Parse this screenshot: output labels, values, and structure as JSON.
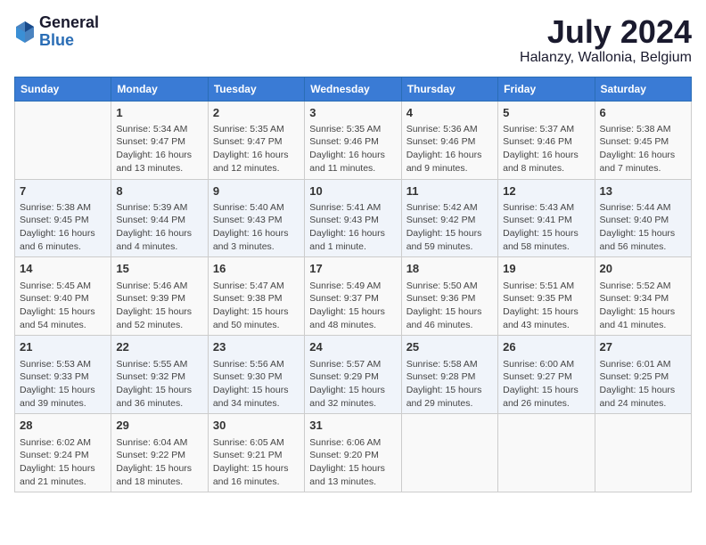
{
  "header": {
    "logo_general": "General",
    "logo_blue": "Blue",
    "month_title": "July 2024",
    "location": "Halanzy, Wallonia, Belgium"
  },
  "days_of_week": [
    "Sunday",
    "Monday",
    "Tuesday",
    "Wednesday",
    "Thursday",
    "Friday",
    "Saturday"
  ],
  "weeks": [
    [
      {
        "day": "",
        "content": ""
      },
      {
        "day": "1",
        "content": "Sunrise: 5:34 AM\nSunset: 9:47 PM\nDaylight: 16 hours\nand 13 minutes."
      },
      {
        "day": "2",
        "content": "Sunrise: 5:35 AM\nSunset: 9:47 PM\nDaylight: 16 hours\nand 12 minutes."
      },
      {
        "day": "3",
        "content": "Sunrise: 5:35 AM\nSunset: 9:46 PM\nDaylight: 16 hours\nand 11 minutes."
      },
      {
        "day": "4",
        "content": "Sunrise: 5:36 AM\nSunset: 9:46 PM\nDaylight: 16 hours\nand 9 minutes."
      },
      {
        "day": "5",
        "content": "Sunrise: 5:37 AM\nSunset: 9:46 PM\nDaylight: 16 hours\nand 8 minutes."
      },
      {
        "day": "6",
        "content": "Sunrise: 5:38 AM\nSunset: 9:45 PM\nDaylight: 16 hours\nand 7 minutes."
      }
    ],
    [
      {
        "day": "7",
        "content": "Sunrise: 5:38 AM\nSunset: 9:45 PM\nDaylight: 16 hours\nand 6 minutes."
      },
      {
        "day": "8",
        "content": "Sunrise: 5:39 AM\nSunset: 9:44 PM\nDaylight: 16 hours\nand 4 minutes."
      },
      {
        "day": "9",
        "content": "Sunrise: 5:40 AM\nSunset: 9:43 PM\nDaylight: 16 hours\nand 3 minutes."
      },
      {
        "day": "10",
        "content": "Sunrise: 5:41 AM\nSunset: 9:43 PM\nDaylight: 16 hours\nand 1 minute."
      },
      {
        "day": "11",
        "content": "Sunrise: 5:42 AM\nSunset: 9:42 PM\nDaylight: 15 hours\nand 59 minutes."
      },
      {
        "day": "12",
        "content": "Sunrise: 5:43 AM\nSunset: 9:41 PM\nDaylight: 15 hours\nand 58 minutes."
      },
      {
        "day": "13",
        "content": "Sunrise: 5:44 AM\nSunset: 9:40 PM\nDaylight: 15 hours\nand 56 minutes."
      }
    ],
    [
      {
        "day": "14",
        "content": "Sunrise: 5:45 AM\nSunset: 9:40 PM\nDaylight: 15 hours\nand 54 minutes."
      },
      {
        "day": "15",
        "content": "Sunrise: 5:46 AM\nSunset: 9:39 PM\nDaylight: 15 hours\nand 52 minutes."
      },
      {
        "day": "16",
        "content": "Sunrise: 5:47 AM\nSunset: 9:38 PM\nDaylight: 15 hours\nand 50 minutes."
      },
      {
        "day": "17",
        "content": "Sunrise: 5:49 AM\nSunset: 9:37 PM\nDaylight: 15 hours\nand 48 minutes."
      },
      {
        "day": "18",
        "content": "Sunrise: 5:50 AM\nSunset: 9:36 PM\nDaylight: 15 hours\nand 46 minutes."
      },
      {
        "day": "19",
        "content": "Sunrise: 5:51 AM\nSunset: 9:35 PM\nDaylight: 15 hours\nand 43 minutes."
      },
      {
        "day": "20",
        "content": "Sunrise: 5:52 AM\nSunset: 9:34 PM\nDaylight: 15 hours\nand 41 minutes."
      }
    ],
    [
      {
        "day": "21",
        "content": "Sunrise: 5:53 AM\nSunset: 9:33 PM\nDaylight: 15 hours\nand 39 minutes."
      },
      {
        "day": "22",
        "content": "Sunrise: 5:55 AM\nSunset: 9:32 PM\nDaylight: 15 hours\nand 36 minutes."
      },
      {
        "day": "23",
        "content": "Sunrise: 5:56 AM\nSunset: 9:30 PM\nDaylight: 15 hours\nand 34 minutes."
      },
      {
        "day": "24",
        "content": "Sunrise: 5:57 AM\nSunset: 9:29 PM\nDaylight: 15 hours\nand 32 minutes."
      },
      {
        "day": "25",
        "content": "Sunrise: 5:58 AM\nSunset: 9:28 PM\nDaylight: 15 hours\nand 29 minutes."
      },
      {
        "day": "26",
        "content": "Sunrise: 6:00 AM\nSunset: 9:27 PM\nDaylight: 15 hours\nand 26 minutes."
      },
      {
        "day": "27",
        "content": "Sunrise: 6:01 AM\nSunset: 9:25 PM\nDaylight: 15 hours\nand 24 minutes."
      }
    ],
    [
      {
        "day": "28",
        "content": "Sunrise: 6:02 AM\nSunset: 9:24 PM\nDaylight: 15 hours\nand 21 minutes."
      },
      {
        "day": "29",
        "content": "Sunrise: 6:04 AM\nSunset: 9:22 PM\nDaylight: 15 hours\nand 18 minutes."
      },
      {
        "day": "30",
        "content": "Sunrise: 6:05 AM\nSunset: 9:21 PM\nDaylight: 15 hours\nand 16 minutes."
      },
      {
        "day": "31",
        "content": "Sunrise: 6:06 AM\nSunset: 9:20 PM\nDaylight: 15 hours\nand 13 minutes."
      },
      {
        "day": "",
        "content": ""
      },
      {
        "day": "",
        "content": ""
      },
      {
        "day": "",
        "content": ""
      }
    ]
  ]
}
